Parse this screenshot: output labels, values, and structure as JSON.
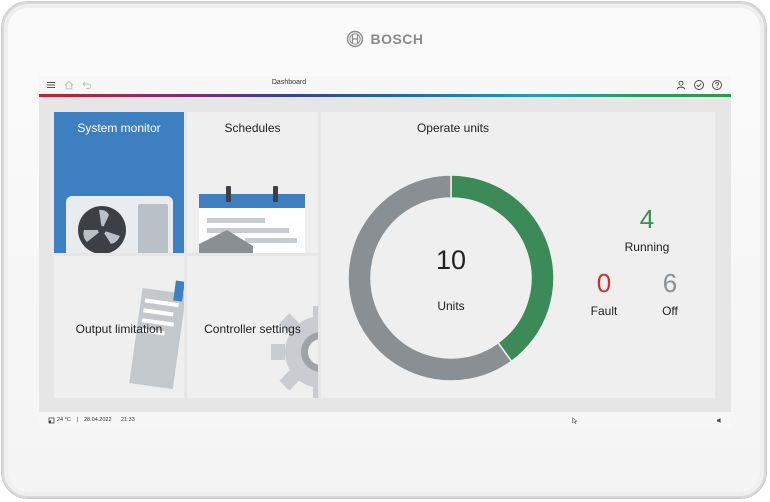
{
  "brand": {
    "name": "BOSCH"
  },
  "topbar": {
    "title": "Dashboard",
    "icons": [
      "menu-icon",
      "home-icon",
      "back-icon",
      "user-icon",
      "check-circle-icon",
      "help-icon"
    ]
  },
  "tiles": {
    "system_monitor": "System monitor",
    "schedules": "Schedules",
    "output_limitation": "Output limitation",
    "controller_settings": "Controller settings"
  },
  "operate": {
    "title": "Operate units",
    "total": "10",
    "total_label": "Units",
    "running": {
      "value": "4",
      "label": "Running",
      "color": "#3b8a57"
    },
    "fault": {
      "value": "0",
      "label": "Fault",
      "color": "#d32f2f"
    },
    "off": {
      "value": "6",
      "label": "Off",
      "color": "#8a8f94"
    }
  },
  "chart_data": {
    "type": "pie",
    "categories": [
      "Running",
      "Off"
    ],
    "values": [
      4,
      6
    ],
    "colors": [
      "#3b8a57",
      "#8a8f94"
    ]
  },
  "statusbar": {
    "temperature": "24 °C",
    "separator": "|",
    "date": "28.04.2022",
    "time": "21:33"
  }
}
